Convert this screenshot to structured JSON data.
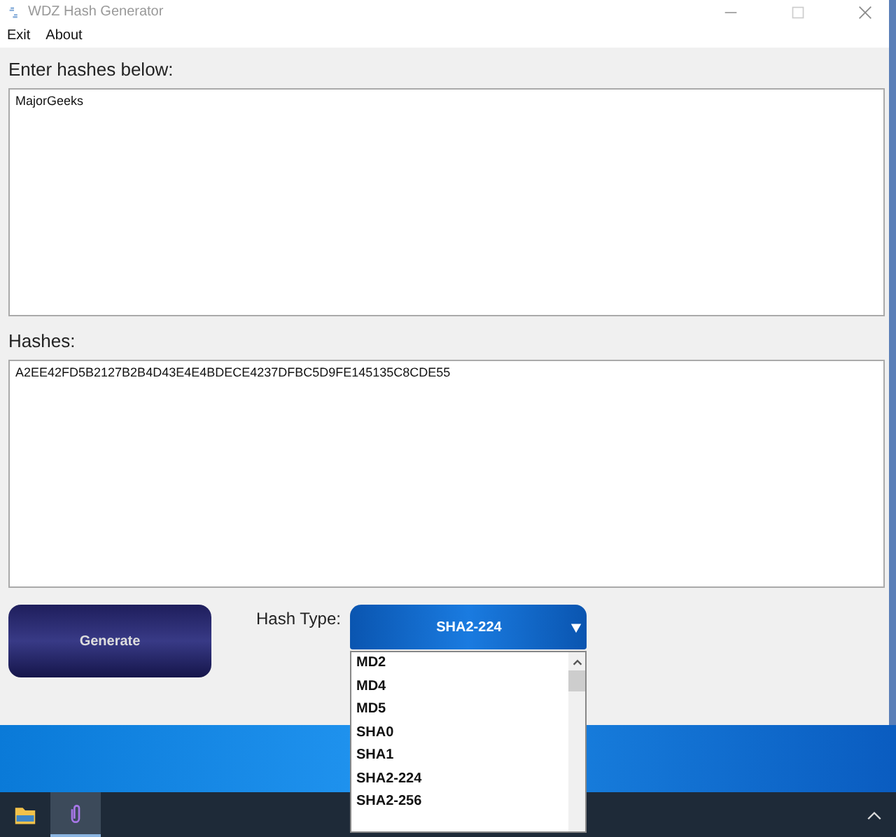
{
  "window": {
    "title": "WDZ Hash Generator"
  },
  "menu": [
    "Exit",
    "About"
  ],
  "input_label": "Enter hashes below:",
  "input_text": "MajorGeeks",
  "output_label": "Hashes:",
  "output_text": "A2EE42FD5B2127B2B4D43E4E4BDECE4237DFBC5D9FE145135C8CDE55",
  "generate_button": "Generate",
  "hash_type_label": "Hash Type:",
  "hash_type": {
    "value": "SHA2-224",
    "expanded": true,
    "options": [
      "MD2",
      "MD4",
      "MD5",
      "SHA0",
      "SHA1",
      "SHA2-224",
      "SHA2-256"
    ]
  },
  "taskbar": {
    "apps": [
      {
        "kind": "folder",
        "active": false
      },
      {
        "kind": "app",
        "active": true
      }
    ]
  }
}
